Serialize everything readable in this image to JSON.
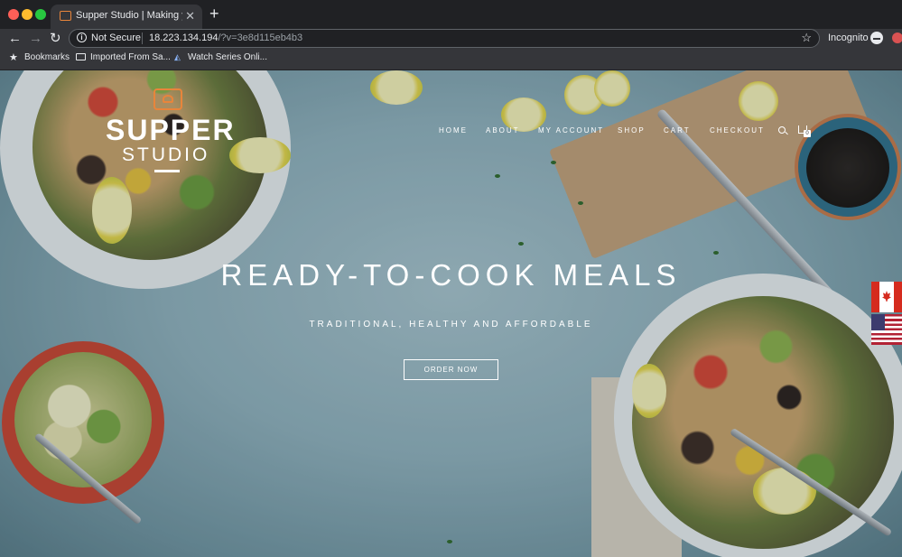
{
  "browser": {
    "tab_title": "Supper Studio | Making your m",
    "new_tab": "+",
    "security_label": "Not Secure",
    "url_host": "18.223.134.194",
    "url_path": "/?v=3e8d115eb4b3",
    "incognito_label": "Incognito",
    "bookmarks": [
      {
        "label": "Bookmarks",
        "icon": "star-icon"
      },
      {
        "label": "Imported From Sa...",
        "icon": "folder-icon"
      },
      {
        "label": "Watch Series Onli...",
        "icon": "watch-icon"
      }
    ]
  },
  "site": {
    "logo_title": "SUPPER",
    "logo_subtitle": "STUDIO",
    "nav": [
      "HOME",
      "ABOUT",
      "MY ACCOUNT",
      "SHOP",
      "CART",
      "CHECKOUT"
    ],
    "cart_count": "0",
    "hero_title": "READY-TO-COOK MEALS",
    "hero_subtitle": "TRADITIONAL, HEALTHY AND AFFORDABLE",
    "cta_label": "ORDER NOW",
    "flags": [
      "canada-flag-icon",
      "usa-flag-icon"
    ]
  },
  "colors": {
    "accent_logo": "#e8853b",
    "background": "#8fb0bb",
    "chrome_dark": "#202124",
    "chrome_toolbar": "#35363a"
  }
}
